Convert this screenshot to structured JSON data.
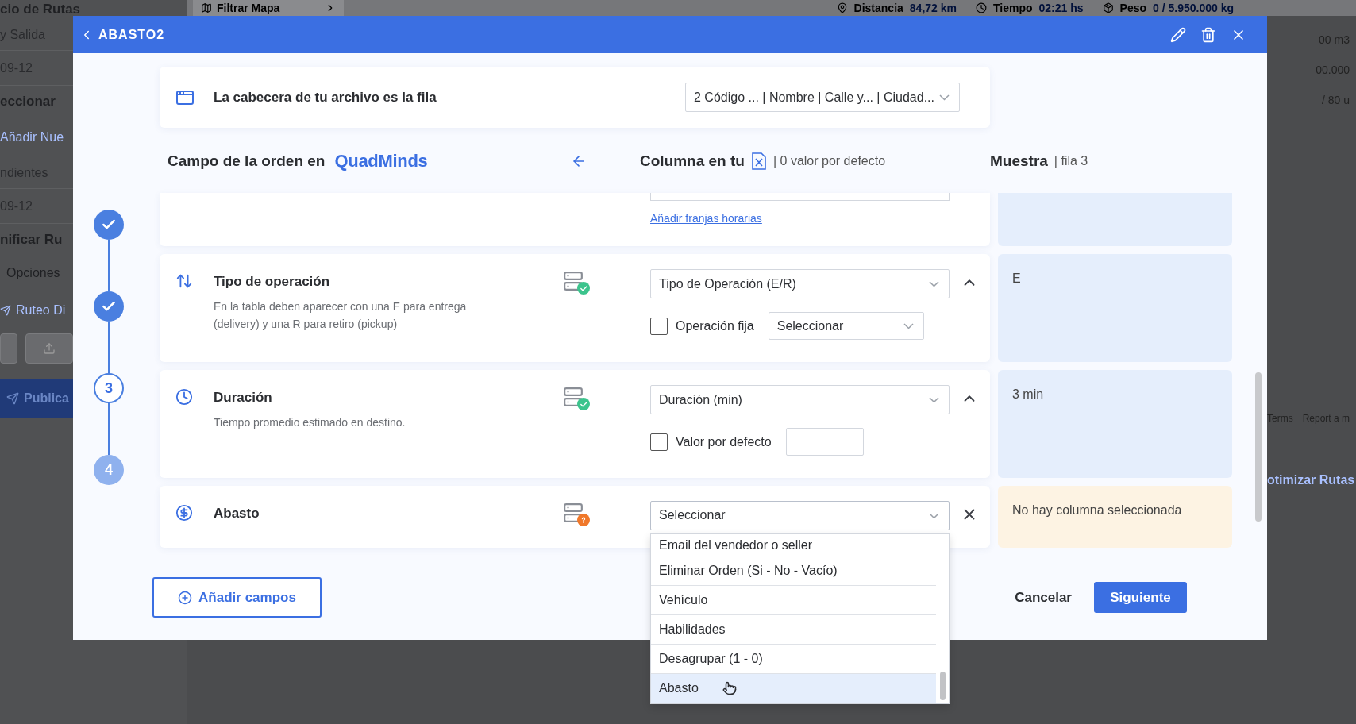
{
  "background": {
    "left_panel": [
      {
        "kind": "heading",
        "text": "cio de Rutas"
      },
      {
        "kind": "label",
        "text": "y Salida"
      },
      {
        "kind": "value",
        "text": "09-12"
      },
      {
        "kind": "heading",
        "text": "eccionar"
      },
      {
        "kind": "link",
        "text": "Añadir Nue"
      },
      {
        "kind": "label",
        "text": "ndientes"
      },
      {
        "kind": "value",
        "text": "09-12"
      },
      {
        "kind": "heading",
        "text": "nificar Ru"
      },
      {
        "kind": "option",
        "text": "Opciones"
      },
      {
        "kind": "link",
        "text": "Ruteo Di"
      },
      {
        "kind": "tools"
      },
      {
        "kind": "button",
        "text": "Publica"
      }
    ],
    "top_bar": {
      "filter_button": "Filtrar Mapa",
      "stats": [
        {
          "label": "Distancia",
          "value": "84,72 km"
        },
        {
          "label": "Tiempo",
          "value": "02:21 hs"
        },
        {
          "label": "Peso",
          "value": "0 / 5.950.000 kg"
        }
      ]
    },
    "right_panel": {
      "values": [
        "00 m3",
        "00.000",
        "/ 80 u"
      ],
      "map_links": [
        "Terms",
        "Report a m"
      ],
      "action": "otimizar Rutas"
    }
  },
  "modal": {
    "title": "ABASTO2",
    "header_row": {
      "label": "La cabecera de tu archivo es la fila",
      "value": "2 Código ... | Nombre | Calle y... | Ciudad..."
    },
    "headings": {
      "field": "Campo de la orden en",
      "logo": "QuadMinds",
      "column": "Columna en tu",
      "column_note": "| 0 valor por defecto",
      "sample": "Muestra",
      "sample_note": "| fila 3"
    },
    "steps": [
      {
        "completed": true,
        "selected": false
      },
      {
        "completed": true,
        "selected": false
      },
      {
        "completed": false,
        "selected": true,
        "label": "3"
      },
      {
        "completed": false,
        "selected": false,
        "label": "4"
      }
    ],
    "partial_row": {
      "link": "Añadir franjas horarias"
    },
    "fields": [
      {
        "title": "Tipo de operación",
        "description": "En la tabla deben aparecer con una E para entrega (delivery) y una R para retiro (pickup)",
        "mapped": true,
        "value": "Tipo de Operación (E/R)",
        "focused": false,
        "expanded": true,
        "removable": false,
        "option": {
          "kind": "select",
          "label": "Operación fija",
          "checked": false,
          "value": "Seleccionar"
        },
        "sample": {
          "text": "E",
          "matched": true
        }
      },
      {
        "title": "Duración",
        "description": "Tiempo promedio estimado en destino.",
        "mapped": true,
        "value": "Duración (min)",
        "focused": false,
        "expanded": true,
        "removable": false,
        "option": {
          "kind": "input",
          "label": "Valor por defecto",
          "checked": false
        },
        "sample": {
          "text": "3 min",
          "matched": true
        }
      },
      {
        "title": "Abasto",
        "mapped": false,
        "value": "Seleccionar",
        "focused": true,
        "removable": true,
        "sample": {
          "text": "No hay columna seleccionada",
          "matched": false
        }
      }
    ],
    "dropdown": [
      {
        "label": "Email del vendedor o seller",
        "selected": false
      },
      {
        "label": "Eliminar Orden (Si - No - Vacío)",
        "selected": false
      },
      {
        "label": "Vehículo",
        "selected": false
      },
      {
        "label": "Habilidades",
        "selected": false
      },
      {
        "label": "Desagrupar (1 - 0)",
        "selected": false
      },
      {
        "label": "Abasto",
        "selected": true
      }
    ],
    "footer": {
      "add": "Añadir campos",
      "cancel": "Cancelar",
      "next": "Siguiente"
    }
  }
}
